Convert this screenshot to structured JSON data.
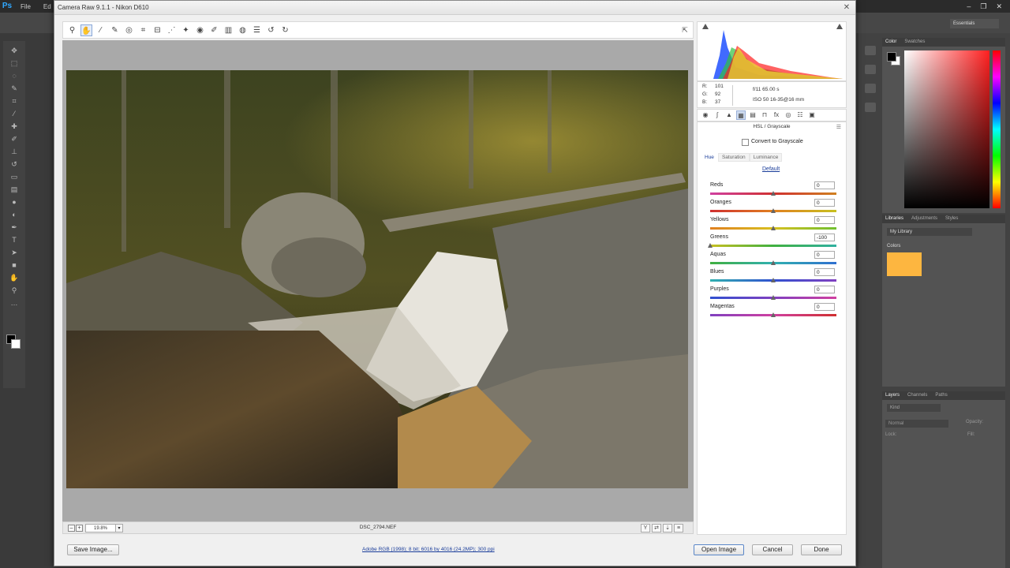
{
  "photoshop": {
    "logo": "Ps",
    "menus": [
      "File",
      "Ed"
    ],
    "workspace": "Essentials",
    "color_panel_tabs": [
      "Color",
      "Swatches"
    ],
    "libraries_panel_tabs": [
      "Libraries",
      "Adjustments",
      "Styles"
    ],
    "library_name": "My Library",
    "library_colors_label": "Colors",
    "library_swatch_color": "#fdb640",
    "layers_panel_tabs": [
      "Layers",
      "Channels",
      "Paths"
    ],
    "layers_kind": "Kind",
    "layers_blend": "Normal",
    "layers_opacity": "Opacity:",
    "layers_lock": "Lock:",
    "layers_fill": "Fill:"
  },
  "dialog": {
    "title": "Camera Raw 9.1.1  -  Nikon D610",
    "zoom": "19.8%",
    "filename": "DSC_2794.NEF",
    "workflow_link": "Adobe RGB (1998); 8 bit; 6016 by 4016 (24.2MP); 300 ppi",
    "buttons": {
      "save": "Save Image...",
      "open": "Open Image",
      "cancel": "Cancel",
      "done": "Done"
    }
  },
  "readout": {
    "r_label": "R:",
    "r": "101",
    "g_label": "G:",
    "g": "92",
    "b_label": "B:",
    "b": "37",
    "camera1": "f/11    65.00 s",
    "camera2": "ISO 50    16-35@16 mm"
  },
  "hsl": {
    "title": "HSL / Grayscale",
    "grayscale_label": "Convert to Grayscale",
    "grayscale_checked": false,
    "tabs": [
      "Hue",
      "Saturation",
      "Luminance"
    ],
    "active_tab": "Hue",
    "default_link": "Default",
    "sliders": [
      {
        "label": "Reds",
        "value": "0",
        "min": -100,
        "max": 100,
        "num": 0,
        "gradient": [
          "#d040a0",
          "#d03030",
          "#d08020"
        ]
      },
      {
        "label": "Oranges",
        "value": "0",
        "min": -100,
        "max": 100,
        "num": 0,
        "gradient": [
          "#d03030",
          "#e08020",
          "#c8c020"
        ]
      },
      {
        "label": "Yellows",
        "value": "0",
        "min": -100,
        "max": 100,
        "num": 0,
        "gradient": [
          "#e08020",
          "#d8c020",
          "#70c030"
        ]
      },
      {
        "label": "Greens",
        "value": "-100",
        "min": -100,
        "max": 100,
        "num": -100,
        "gradient": [
          "#c8c020",
          "#40b040",
          "#30b0a0"
        ]
      },
      {
        "label": "Aquas",
        "value": "0",
        "min": -100,
        "max": 100,
        "num": 0,
        "gradient": [
          "#40b040",
          "#30b0b0",
          "#3070d0"
        ]
      },
      {
        "label": "Blues",
        "value": "0",
        "min": -100,
        "max": 100,
        "num": 0,
        "gradient": [
          "#30b0b0",
          "#3050d0",
          "#8040c0"
        ]
      },
      {
        "label": "Purples",
        "value": "0",
        "min": -100,
        "max": 100,
        "num": 0,
        "gradient": [
          "#3050d0",
          "#8040c0",
          "#d040a0"
        ]
      },
      {
        "label": "Magentas",
        "value": "0",
        "min": -100,
        "max": 100,
        "num": 0,
        "gradient": [
          "#8040c0",
          "#d040a0",
          "#d03030"
        ]
      }
    ]
  },
  "colors": {
    "accent_link": "#1a3d9a",
    "ps_blue": "#31a8ff"
  }
}
